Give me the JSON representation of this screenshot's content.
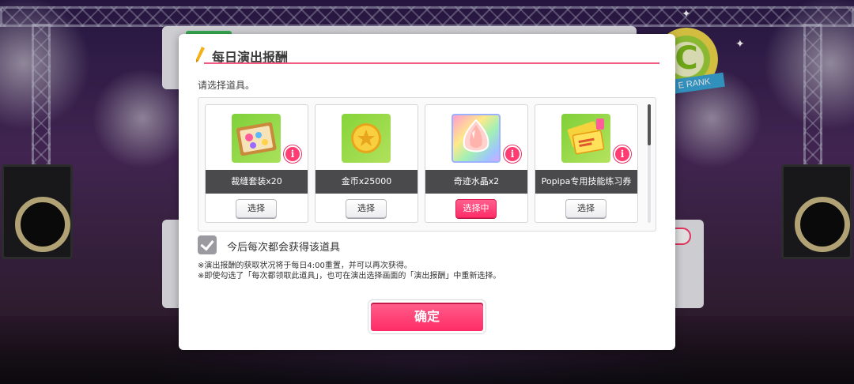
{
  "background": {
    "rank_letter": "C",
    "rank_ribbon": "E RANK"
  },
  "dialog": {
    "title": "每日演出报酬",
    "prompt": "请选择道具。",
    "items": [
      {
        "name": "裁缝套装x20",
        "select_label": "选择",
        "selected": false,
        "icon": "sewing-kit-icon"
      },
      {
        "name": "金币x25000",
        "select_label": "选择",
        "selected": false,
        "icon": "gold-coin-icon"
      },
      {
        "name": "奇迹水晶x2",
        "select_label": "选择中",
        "selected": true,
        "icon": "miracle-crystal-icon"
      },
      {
        "name": "Popipa专用技能练习券",
        "select_label": "选择",
        "selected": false,
        "icon": "skill-ticket-icon"
      }
    ],
    "info_glyph": "i",
    "checkbox": {
      "checked": true,
      "label": "今后每次都会获得该道具"
    },
    "notes": [
      "※演出报酬的获取状况将于每日4:00重置，并可以再次获得。",
      "※即使勾选了「每次都领取此道具」，也可在演出选择画面的「演出报酬」中重新选择。"
    ],
    "confirm_label": "确定"
  },
  "colors": {
    "accent": "#ff3d73",
    "title_rule": "#f25b80",
    "item_bar": "#4a4a4d"
  }
}
